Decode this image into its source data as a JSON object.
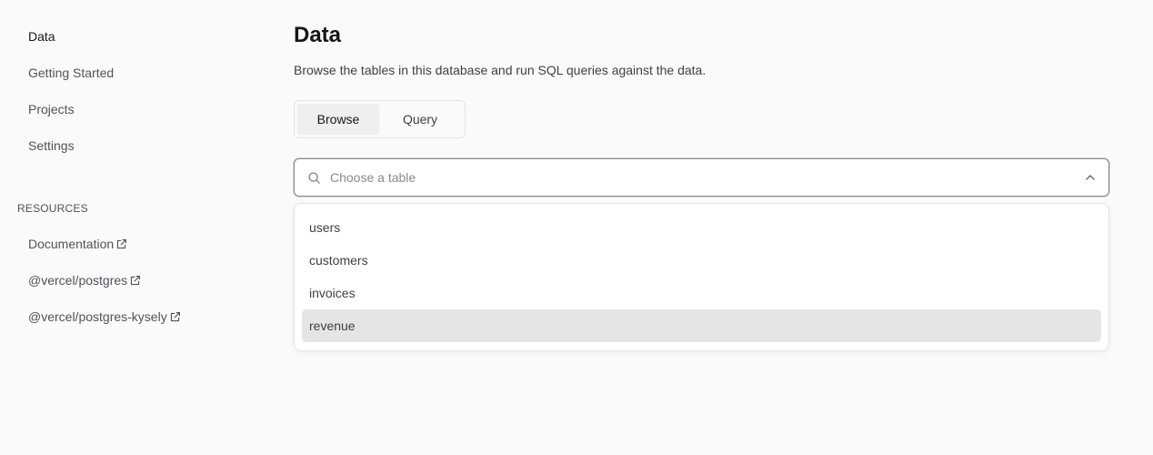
{
  "sidebar": {
    "nav": [
      {
        "label": "Data"
      },
      {
        "label": "Getting Started"
      },
      {
        "label": "Projects"
      },
      {
        "label": "Settings"
      }
    ],
    "resources_title": "RESOURCES",
    "resources": [
      {
        "label": "Documentation",
        "icon": "external-link-icon"
      },
      {
        "label": "@vercel/postgres",
        "icon": "external-link-icon"
      },
      {
        "label": "@vercel/postgres-kysely",
        "icon": "external-link-icon"
      }
    ]
  },
  "main": {
    "title": "Data",
    "description": "Browse the tables in this database and run SQL queries against the data.",
    "tabs": [
      {
        "label": "Browse"
      },
      {
        "label": "Query"
      }
    ],
    "table_picker": {
      "placeholder": "Choose a table",
      "value": "",
      "search_icon": "search-icon",
      "toggle_icon": "chevron-up-icon",
      "options": [
        "users",
        "customers",
        "invoices",
        "revenue"
      ],
      "highlighted_option": "revenue"
    }
  },
  "colors": {
    "background": "#fafafa",
    "text": "#171717",
    "muted_text": "#52525b",
    "highlight": "#e5e5e5"
  }
}
